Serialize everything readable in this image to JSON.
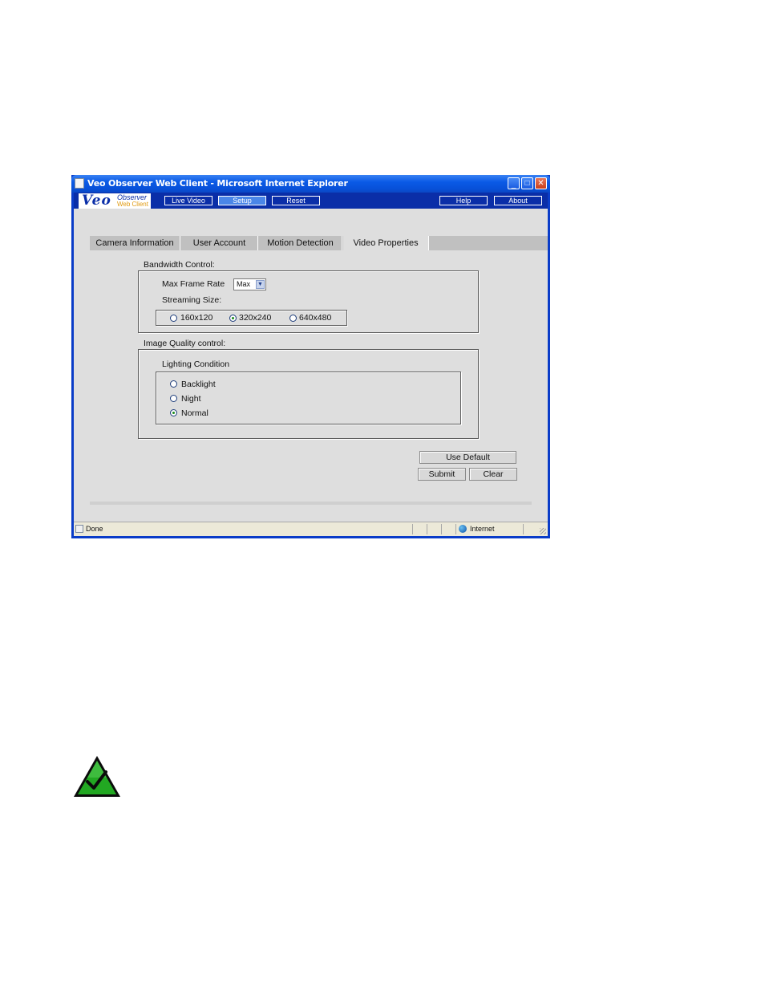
{
  "window": {
    "title": "Veo Observer Web Client - Microsoft Internet Explorer",
    "controls": {
      "minimize": "_",
      "maximize": "□",
      "close": "✕"
    }
  },
  "app": {
    "logo": {
      "brand": "Veo",
      "line1": "Observer",
      "line2": "Web Client"
    },
    "nav": [
      "Live Video",
      "Setup",
      "Reset",
      "Help",
      "About"
    ],
    "active_nav": "Setup"
  },
  "tabs": [
    "Camera Information",
    "User Account",
    "Motion Detection",
    "Video Properties"
  ],
  "active_tab": "Video Properties",
  "bandwidth": {
    "heading": "Bandwidth Control:",
    "max_frame_rate_label": "Max Frame Rate",
    "max_frame_rate_value": "Max",
    "streaming_size_label": "Streaming Size:",
    "sizes": [
      {
        "label": "160x120",
        "checked": false
      },
      {
        "label": "320x240",
        "checked": true
      },
      {
        "label": "640x480",
        "checked": false
      }
    ]
  },
  "image_quality": {
    "heading": "Image Quality control:",
    "lighting_label": "Lighting Condition",
    "options": [
      {
        "label": "Backlight",
        "checked": false
      },
      {
        "label": "Night",
        "checked": false
      },
      {
        "label": "Normal",
        "checked": true
      }
    ]
  },
  "buttons": {
    "use_default": "Use Default",
    "submit": "Submit",
    "clear": "Clear"
  },
  "statusbar": {
    "status": "Done",
    "zone": "Internet"
  },
  "colors": {
    "titlebar": "#0a5ae6",
    "appbar": "#0a2ea8",
    "panel": "#dedede",
    "note_icon": "#22a822"
  },
  "icons": {
    "note": "green-check-triangle-icon"
  }
}
